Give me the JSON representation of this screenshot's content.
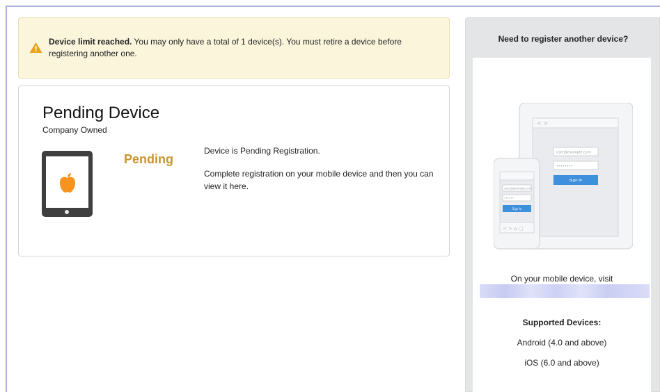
{
  "alert": {
    "icon": "warning-icon",
    "color": "#e8a317",
    "bold_text": "Device limit reached.",
    "text": " You may only have a total of 1 device(s). You must retire a device before registering another one."
  },
  "device": {
    "title": "Pending Device",
    "ownership": "Company Owned",
    "icon": "apple-icon",
    "icon_color": "#f7931e",
    "status": "Pending",
    "status_color": "#c9952c",
    "description": "Device is Pending Registration.",
    "instructions": "Complete registration on your mobile device and then you can view it here."
  },
  "side_panel": {
    "heading": "Need to register another device?",
    "illustration": {
      "tablet_email": "user@example.com",
      "tablet_password": "••••••••",
      "sign_in_label": "Sign In",
      "phone_email": "user@example.com",
      "phone_password": "••••••",
      "phone_sign_in": "Sign In"
    },
    "visit_text": "On your mobile device, visit",
    "supported_heading": "Supported Devices:",
    "android": "Android (4.0 and above)",
    "ios": "iOS (6.0 and above)"
  }
}
